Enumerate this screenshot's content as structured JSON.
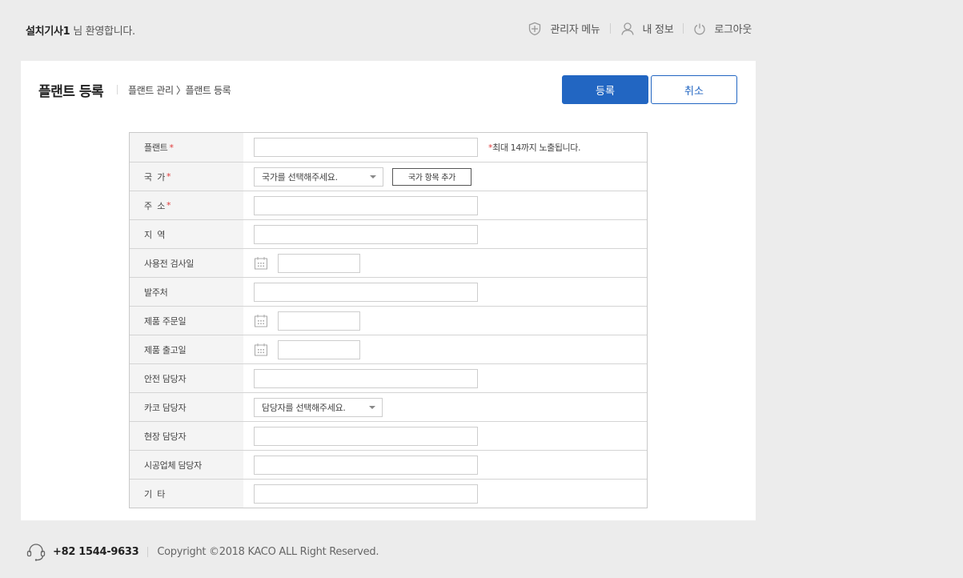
{
  "header": {
    "user_name": "설치기사1",
    "welcome_suffix": " 님 환영합니다.",
    "nav": {
      "admin_menu": "관리자 메뉴",
      "my_info": "내 정보",
      "logout": "로그아웃"
    }
  },
  "page": {
    "title": "플랜트 등록",
    "breadcrumb": "플랜트 관리 〉플랜트 등록",
    "register_button": "등록",
    "cancel_button": "취소"
  },
  "form": {
    "plant": {
      "label": "플랜트",
      "required": "*",
      "value": "",
      "note_star": "*",
      "note": "최대 14까지 노출됩니다."
    },
    "country": {
      "label": "국  가",
      "required": "*",
      "selected": "국가를 선택해주세요.",
      "add_button": "국가 항목 추가"
    },
    "address": {
      "label": "주  소",
      "required": "*",
      "value": ""
    },
    "region": {
      "label": "지  역",
      "value": ""
    },
    "inspection_date": {
      "label": "사용전 검사일",
      "value": ""
    },
    "client": {
      "label": "발주처",
      "value": ""
    },
    "order_date": {
      "label": "제품 주문일",
      "value": ""
    },
    "ship_date": {
      "label": "제품 출고일",
      "value": ""
    },
    "safety_manager": {
      "label": "안전 담당자",
      "value": ""
    },
    "kaco_manager": {
      "label": "카코 담당자",
      "selected": "담당자를 선택해주세요."
    },
    "site_manager": {
      "label": "현장 담당자",
      "value": ""
    },
    "contractor_manager": {
      "label": "시공업체 담당자",
      "value": ""
    },
    "etc": {
      "label": "기  타",
      "value": ""
    }
  },
  "footer": {
    "phone": "+82 1544-9633",
    "copyright": "Copyright ©2018 KACO ALL Right Reserved."
  },
  "colors": {
    "primary": "#2266c2",
    "required": "#e03a3a",
    "background": "#ececec"
  },
  "icons": [
    "shield-icon",
    "user-icon",
    "power-icon",
    "calendar-icon",
    "headset-icon",
    "chevron-down-icon"
  ]
}
